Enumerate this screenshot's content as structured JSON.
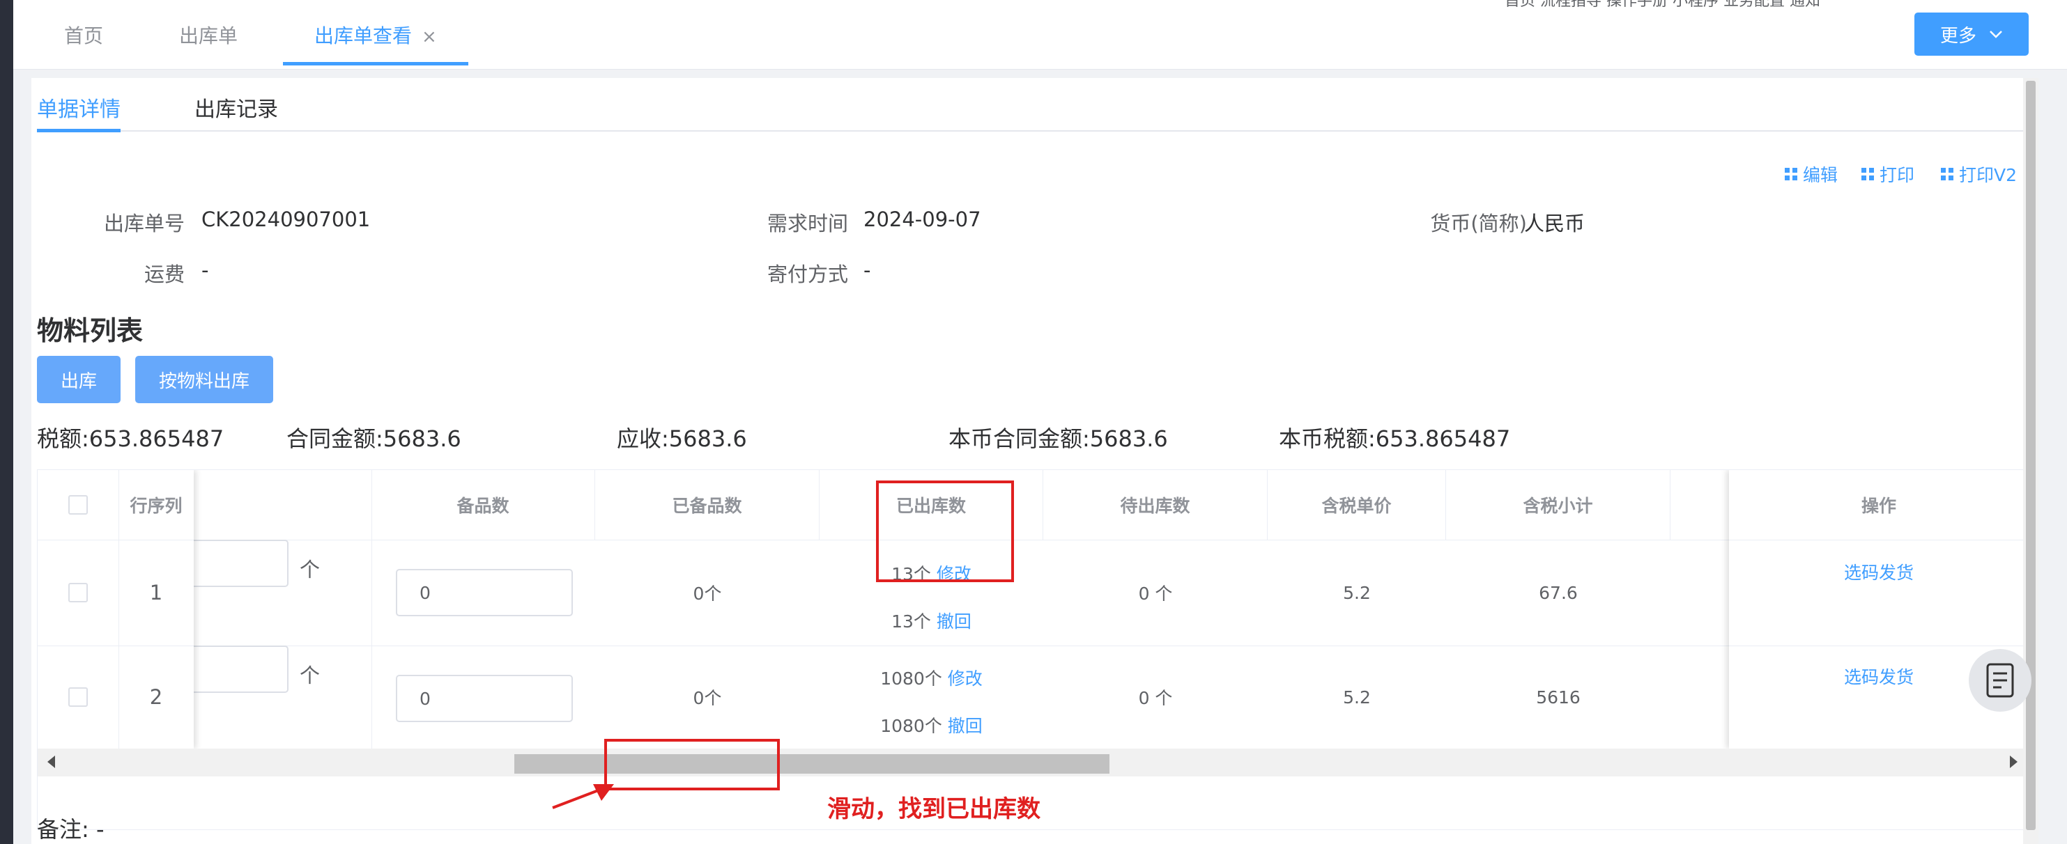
{
  "top_tabs": [
    {
      "label": "首页"
    },
    {
      "label": "出库单"
    },
    {
      "label": "出库单查看"
    }
  ],
  "top_strip_text": "首页   流程指导  操作手册   小程序   业务配置   通知",
  "more_button": "更多",
  "sub_tabs": [
    {
      "label": "单据详情"
    },
    {
      "label": "出库记录"
    }
  ],
  "actions": {
    "edit": "编辑",
    "print": "打印",
    "print_v2": "打印V2"
  },
  "fields": {
    "order_no_label": "出库单号",
    "order_no": "CK20240907001",
    "demand_time_label": "需求时间",
    "demand_time": "2024-09-07",
    "currency_label": "货币(简称)",
    "currency": "人民币",
    "freight_label": "运费",
    "freight": "-",
    "delivery_label": "寄付方式",
    "delivery": "-"
  },
  "section_title": "物料列表",
  "buttons": {
    "outbound": "出库",
    "outbound_by_material": "按物料出库"
  },
  "stats": {
    "tax": "税额:653.865487",
    "contract_amount": "合同金额:5683.6",
    "receivable": "应收:5683.6",
    "local_contract_amount": "本币合同金额:5683.6",
    "local_tax": "本币税额:653.865487"
  },
  "table": {
    "headers": {
      "row_seq": "行序列",
      "spare_qty": "备品数",
      "spared": "已备品数",
      "shipped": "已出库数",
      "pending": "待出库数",
      "unit_price": "含税单价",
      "subtotal": "含税小计",
      "ops": "操作"
    },
    "rows": [
      {
        "seq": "1",
        "unit": "个",
        "spare_input": "0",
        "spared": "0个",
        "shipped_a": "13个",
        "shipped_b": "13个",
        "pending": "0 个",
        "price": "5.2",
        "subtotal": "67.6",
        "op": "选码发货"
      },
      {
        "seq": "2",
        "unit": "个",
        "spare_input": "0",
        "spared": "0个",
        "shipped_a": "1080个",
        "shipped_b": "1080个",
        "pending": "0 个",
        "price": "5.2",
        "subtotal": "5616",
        "op": "选码发货"
      }
    ],
    "modify": "修改",
    "revoke": "撤回"
  },
  "remark": "备注:  -",
  "annotation": "滑动，找到已出库数",
  "colors": {
    "accent": "#409eff",
    "annotation": "#e02020"
  }
}
